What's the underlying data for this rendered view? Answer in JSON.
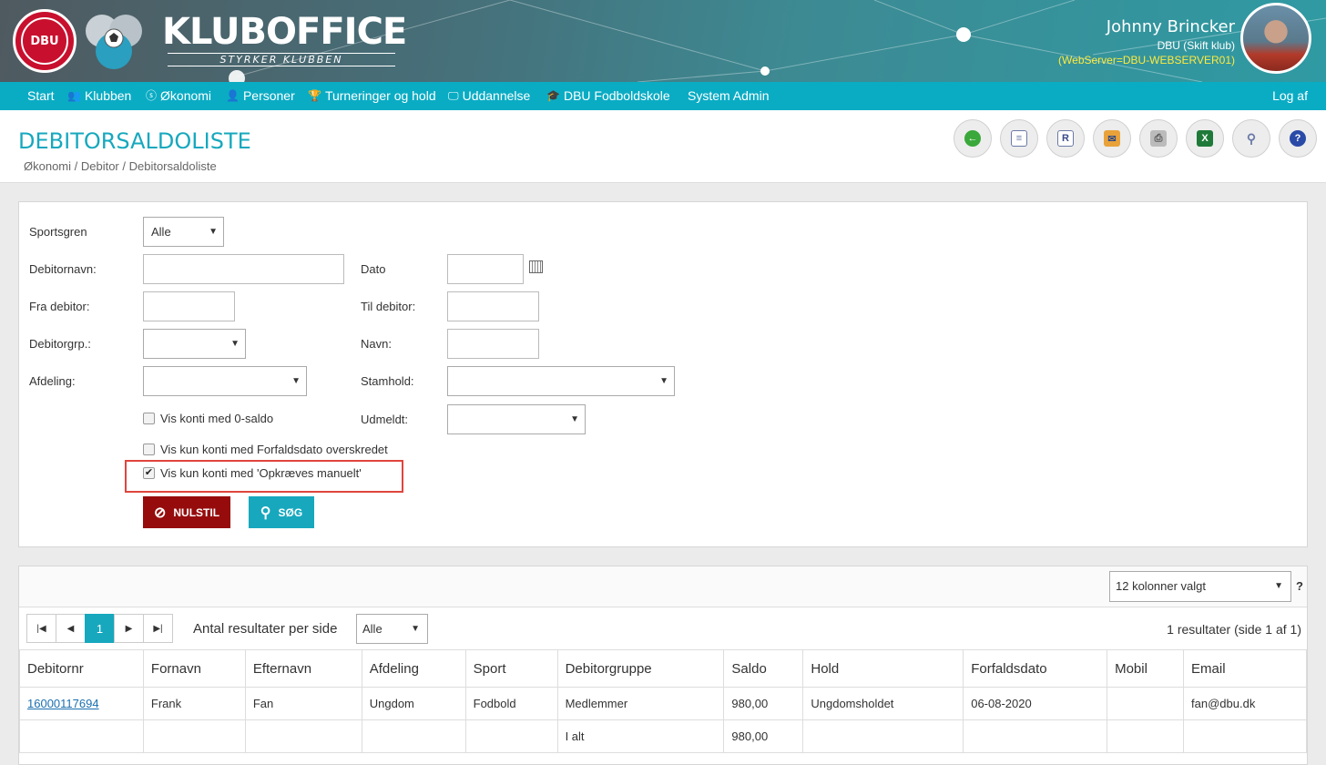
{
  "header": {
    "dbu_logo_text": "DBU",
    "brand_name": "KLUBOFFICE",
    "brand_tagline": "STYRKER KLUBBEN",
    "user_name": "Johnny Brincker",
    "club": "DBU (Skift klub)",
    "server": "(WebServer=DBU-WEBSERVER01)"
  },
  "nav": {
    "items": [
      "Start",
      "Klubben",
      "Økonomi",
      "Personer",
      "Turneringer og hold",
      "Uddannelse",
      "DBU Fodboldskole",
      "System Admin"
    ],
    "logout": "Log af"
  },
  "page": {
    "title": "DEBITORSALDOLISTE",
    "breadcrumb": "Økonomi / Debitor / Debitorsaldoliste"
  },
  "filters": {
    "sportsgren_label": "Sportsgren",
    "sportsgren_value": "Alle",
    "debitornavn_label": "Debitornavn:",
    "dato_label": "Dato",
    "fra_debitor_label": "Fra debitor:",
    "til_debitor_label": "Til debitor:",
    "debitorgrp_label": "Debitorgrp.:",
    "navn_label": "Navn:",
    "afdeling_label": "Afdeling:",
    "stamhold_label": "Stamhold:",
    "udmeldt_label": "Udmeldt:",
    "chk_zero": "Vis konti med 0-saldo",
    "chk_overdue": "Vis kun konti med Forfaldsdato overskredet",
    "chk_manual": "Vis kun konti med 'Opkræves manuelt'",
    "reset_label": "NULSTIL",
    "search_label": "SØG"
  },
  "results": {
    "columns_selected": "12 kolonner valgt",
    "help": "?",
    "page_current": "1",
    "per_page_label": "Antal resultater per side",
    "per_page_value": "Alle",
    "count": "1 resultater (side 1 af 1)",
    "headers": [
      "Debitornr",
      "Fornavn",
      "Efternavn",
      "Afdeling",
      "Sport",
      "Debitorgruppe",
      "Saldo",
      "Hold",
      "Forfaldsdato",
      "Mobil",
      "Email"
    ],
    "rows": [
      [
        "16000117694",
        "Frank",
        "Fan",
        "Ungdom",
        "Fodbold",
        "Medlemmer",
        "980,00",
        "Ungdomsholdet",
        "06-08-2020",
        "",
        "fan@dbu.dk"
      ]
    ],
    "total_label": "I alt",
    "total_value": "980,00"
  },
  "colors": {
    "accent": "#17a8be",
    "nav": "#0aacc4",
    "reset": "#960c0c",
    "highlight": "#e0453d"
  }
}
